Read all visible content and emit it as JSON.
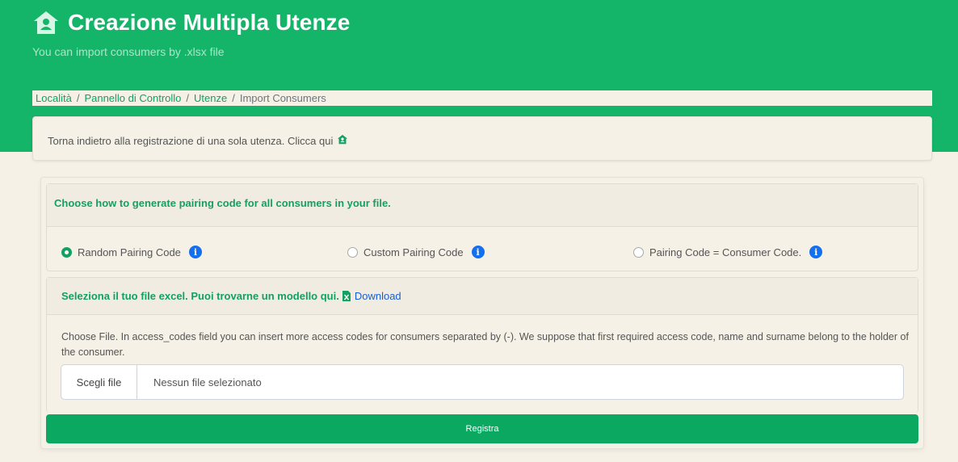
{
  "header": {
    "icon": "home-user-icon",
    "title": "Creazione Multipla Utenze",
    "subtitle": "You can import consumers by .xlsx file"
  },
  "breadcrumb": {
    "items": [
      "Località",
      "Pannello di Controllo",
      "Utenze"
    ],
    "separator": "/",
    "current": "Import Consumers"
  },
  "back_notice": {
    "text": "Torna indietro alla registrazione di una sola utenza. Clicca qui",
    "icon": "home-user-icon"
  },
  "pairing": {
    "heading": "Choose how to generate pairing code for all consumers in your file.",
    "options": [
      {
        "label": "Random Pairing Code",
        "checked": true
      },
      {
        "label": "Custom Pairing Code",
        "checked": false
      },
      {
        "label": "Pairing Code = Consumer Code.",
        "checked": false
      }
    ],
    "info_glyph": "i"
  },
  "file_section": {
    "heading": "Seleziona il tuo file excel. Puoi trovarne un modello qui.",
    "download_icon": "excel-file-icon",
    "download_label": "Download",
    "description": "Choose File. In access_codes field you can insert more access codes for consumers separated by (-). We suppose that first required access code, name and surname belong to the holder of the consumer.",
    "choose_button": "Scegli file",
    "no_file": "Nessun file selezionato"
  },
  "submit_label": "Registra",
  "colors": {
    "brand_green": "#14b469",
    "link_green": "#14a060",
    "info_blue": "#1570ef",
    "background": "#f5f1e6"
  }
}
